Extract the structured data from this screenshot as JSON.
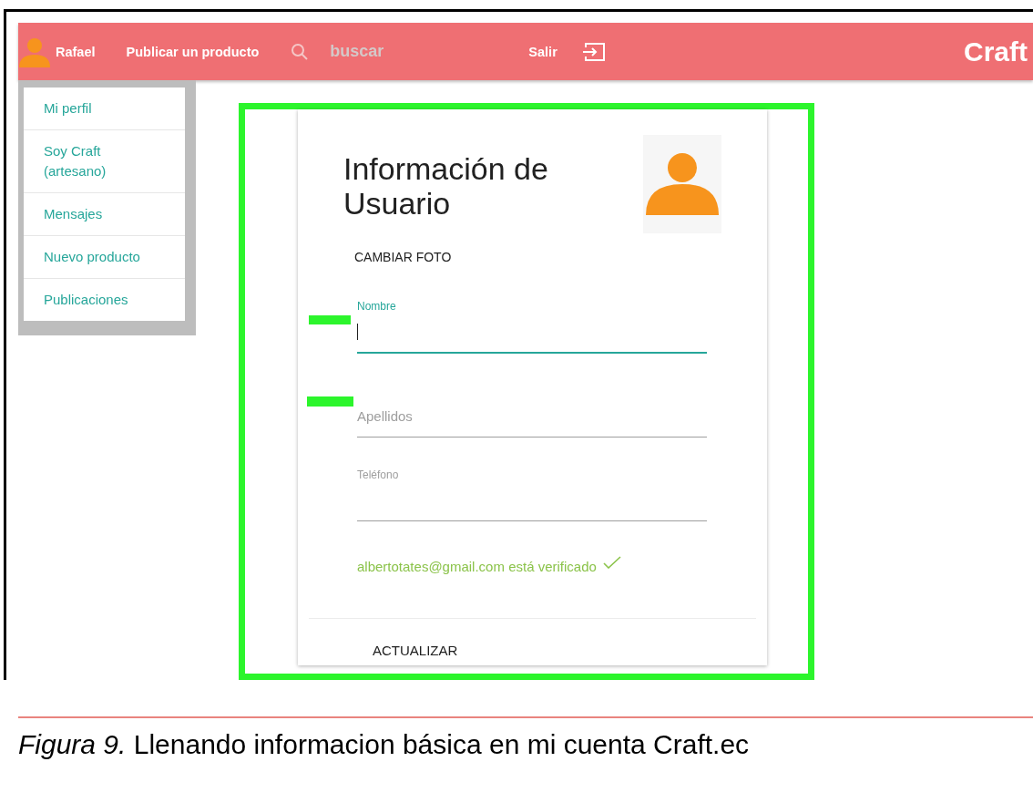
{
  "navbar": {
    "user": "Rafael",
    "links": [
      {
        "label": "Publicar un producto"
      }
    ],
    "search": {
      "placeholder": "buscar"
    },
    "logout": "Salir",
    "brand": "Craft"
  },
  "sidebar": {
    "items": [
      {
        "label": "Mi perfil"
      },
      {
        "label": "Soy Craft (artesano)"
      },
      {
        "label": "Mensajes"
      },
      {
        "label": "Nuevo producto"
      },
      {
        "label": "Publicaciones"
      }
    ]
  },
  "card": {
    "title": "Información de Usuario",
    "change_photo": "CAMBIAR FOTO",
    "fields": [
      {
        "label": "Nombre",
        "focused": true,
        "floated": true
      },
      {
        "label": "Apellidos",
        "focused": false,
        "floated": false
      },
      {
        "label": "Teléfono",
        "focused": false,
        "floated": true
      }
    ],
    "verified": "albertotates@gmail.com está verificado",
    "submit": "ACTUALIZAR"
  },
  "caption": "*Figura 9.* Llenando informacion básica en mi cuenta Craft.ec"
}
